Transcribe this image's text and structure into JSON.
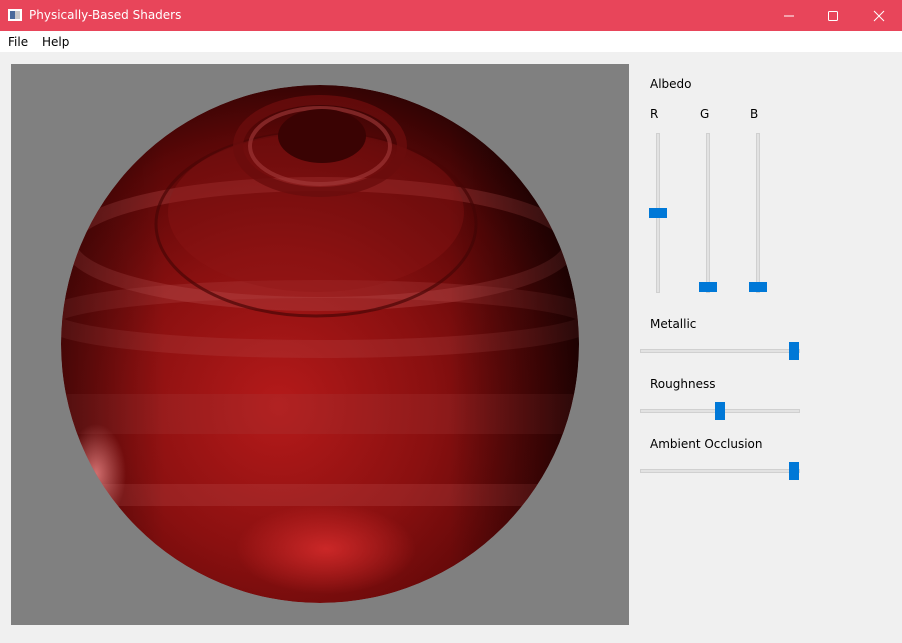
{
  "window": {
    "title": "Physically-Based Shaders",
    "accent_color": "#e8455a"
  },
  "menu": {
    "items": [
      {
        "label": "File"
      },
      {
        "label": "Help"
      }
    ]
  },
  "viewport": {
    "background_color": "#808080",
    "object": "sphere",
    "base_color": "#8b1010"
  },
  "controls": {
    "albedo": {
      "label": "Albedo",
      "channels": [
        {
          "label": "R",
          "value_fraction": 0.5
        },
        {
          "label": "G",
          "value_fraction": 0.0
        },
        {
          "label": "B",
          "value_fraction": 0.0
        }
      ]
    },
    "metallic": {
      "label": "Metallic",
      "value_fraction": 1.0
    },
    "roughness": {
      "label": "Roughness",
      "value_fraction": 0.5
    },
    "ambient_occlusion": {
      "label": "Ambient Occlusion",
      "value_fraction": 1.0
    }
  },
  "icons": {
    "app": "app-icon",
    "minimize": "minimize-icon",
    "maximize": "maximize-icon",
    "close": "close-icon"
  },
  "slider_color": "#0078d7"
}
